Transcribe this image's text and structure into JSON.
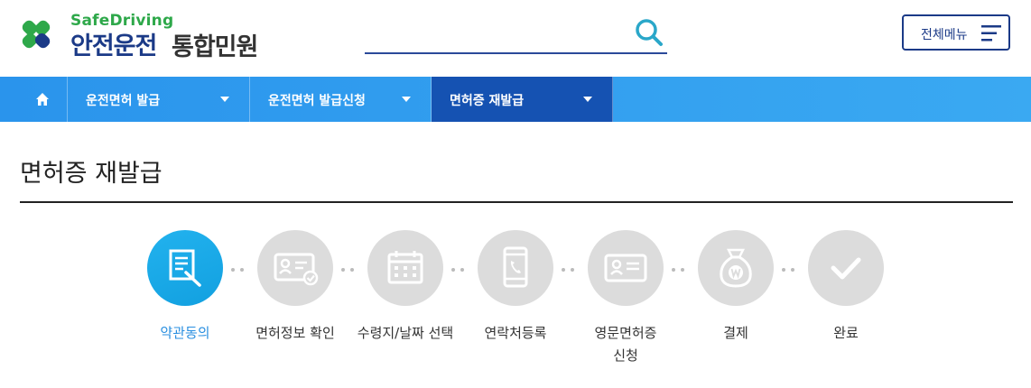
{
  "header": {
    "logo_sub": "SafeDriving",
    "logo_main": "안전운전",
    "logo_main2": "통합민원",
    "search": {
      "value": "",
      "placeholder": ""
    },
    "menu_button_label": "전체메뉴"
  },
  "nav": {
    "home_icon": "home-icon",
    "items": [
      {
        "label": "운전면허 발급",
        "active": false
      },
      {
        "label": "운전면허 발급신청",
        "active": false
      },
      {
        "label": "면허증 재발급",
        "active": true
      }
    ]
  },
  "page_title": "면허증 재발급",
  "steps": [
    {
      "label": "약관동의",
      "icon": "document-pen-icon",
      "active": true
    },
    {
      "label": "면허정보 확인",
      "icon": "id-card-check-icon",
      "active": false
    },
    {
      "label": "수령지/날짜 선택",
      "icon": "calendar-icon",
      "active": false
    },
    {
      "label": "연락처등록",
      "icon": "phone-icon",
      "active": false
    },
    {
      "label": "영문면허증\n신청",
      "icon": "id-card-icon",
      "active": false
    },
    {
      "label": "결제",
      "icon": "money-bag-icon",
      "active": false
    },
    {
      "label": "완료",
      "icon": "check-icon",
      "active": false
    }
  ],
  "colors": {
    "brand_navy": "#1b3a87",
    "brand_green": "#2ea84a",
    "nav_blue": "#2a94ec",
    "nav_active": "#1552b2",
    "step_active": "#12a0e0",
    "step_inactive": "#dcdcdc"
  }
}
